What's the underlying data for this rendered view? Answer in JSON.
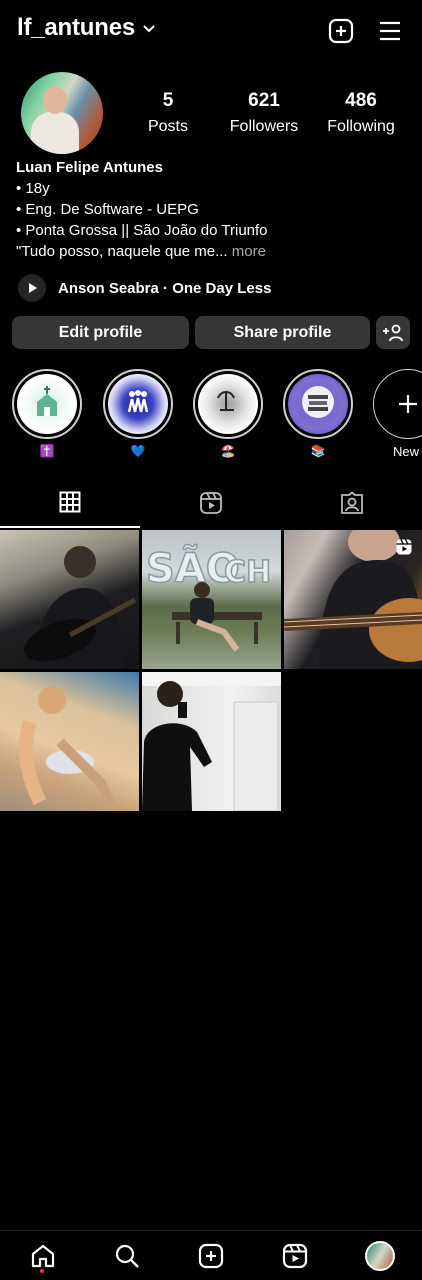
{
  "header": {
    "username": "lf_antunes",
    "icons": [
      "chevron-down-icon",
      "add-square-icon",
      "menu-icon"
    ]
  },
  "profile": {
    "stats": [
      {
        "value": "5",
        "label": "Posts"
      },
      {
        "value": "621",
        "label": "Followers"
      },
      {
        "value": "486",
        "label": "Following"
      }
    ],
    "name": "Luan Felipe Antunes",
    "bio_lines": [
      "• 18y",
      "• Eng. De Software - UEPG",
      "• Ponta Grossa || São João do Triunfo"
    ],
    "bio_truncated": "\"Tudo posso, naquele que me...",
    "more_label": " more",
    "music": "Anson Seabra · One Day Less"
  },
  "buttons": {
    "edit": "Edit profile",
    "share": "Share profile"
  },
  "highlights": [
    {
      "label": "✝️"
    },
    {
      "label": "💙"
    },
    {
      "label": "🏖️"
    },
    {
      "label": "📚"
    },
    {
      "label": "New"
    }
  ],
  "tabs": [
    "grid-icon",
    "reels-icon",
    "tagged-icon"
  ],
  "posts_count_shown": 5,
  "bottom_nav": [
    "home-icon",
    "search-icon",
    "create-icon",
    "reels-icon",
    "profile-avatar"
  ],
  "colors": {
    "background": "#000000",
    "button": "#363636",
    "muted_text": "#a8a8a8",
    "notification_dot": "#ff3040"
  }
}
